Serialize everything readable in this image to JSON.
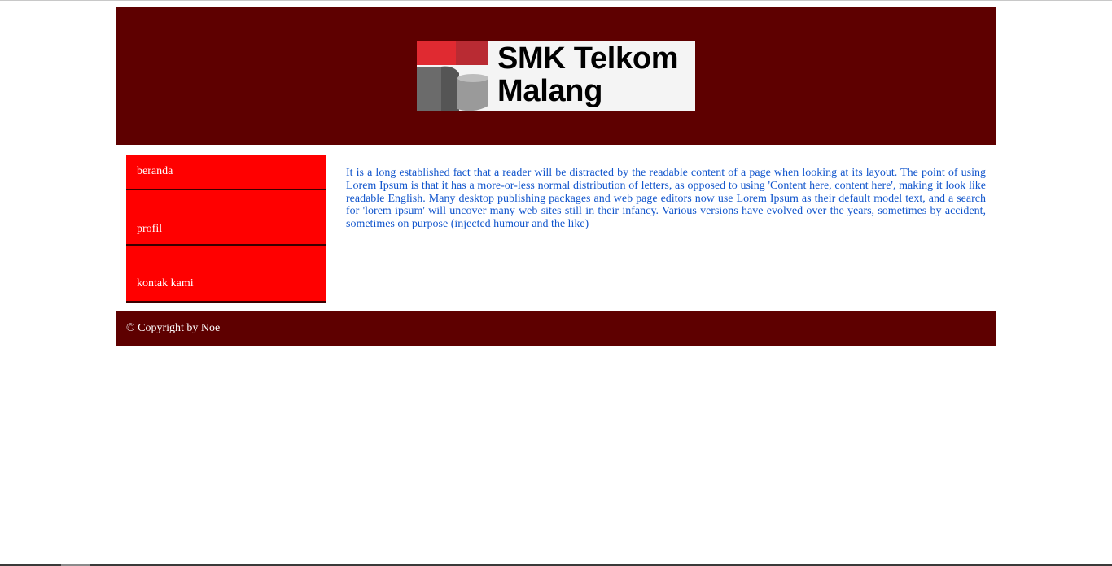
{
  "header": {
    "logo": {
      "line1": "SMK Telkom",
      "line2": "Malang"
    }
  },
  "sidebar": {
    "items": [
      {
        "label": "beranda"
      },
      {
        "label": "profil"
      },
      {
        "label": "kontak kami"
      }
    ]
  },
  "main": {
    "paragraph": "It is a long established fact that a reader will be distracted by the readable content of a page when looking at its layout. The point of using Lorem Ipsum is that it has a more-or-less normal distribution of letters, as opposed to using 'Content here, content here', making it look like readable English. Many desktop publishing packages and web page editors now use Lorem Ipsum as their default model text, and a search for 'lorem ipsum' will uncover many web sites still in their infancy. Various versions have evolved over the years, sometimes by accident, sometimes on purpose (injected humour and the like)"
  },
  "footer": {
    "text": "© Copyright by Noe"
  },
  "colors": {
    "header_bg": "#5e0000",
    "nav_bg": "#ff0000",
    "content_text": "#1155cc",
    "logo_red": "#e02a31",
    "logo_gray": "#6b6b6b"
  }
}
